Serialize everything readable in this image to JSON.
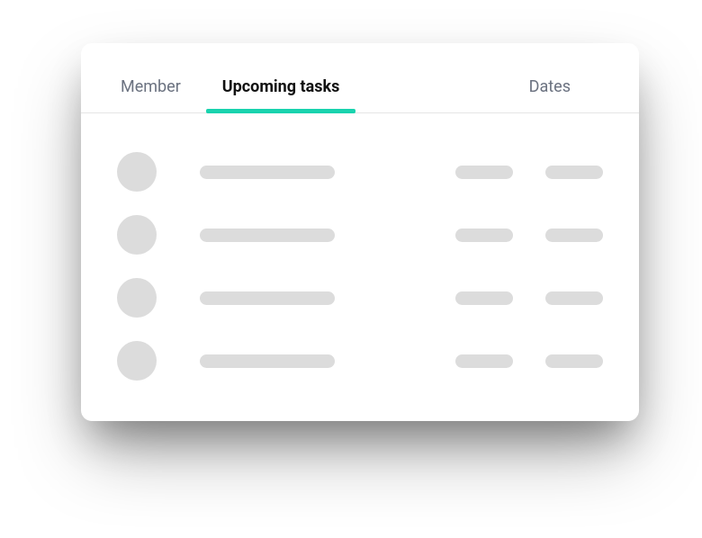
{
  "tabs": {
    "member": "Member",
    "upcoming": "Upcoming tasks",
    "dates": "Dates",
    "active": "upcoming"
  },
  "accent_color": "#19d3ae",
  "placeholder_color": "#dcdcdc",
  "rows": [
    {
      "avatar": "",
      "task": "",
      "date_start": "",
      "date_end": ""
    },
    {
      "avatar": "",
      "task": "",
      "date_start": "",
      "date_end": ""
    },
    {
      "avatar": "",
      "task": "",
      "date_start": "",
      "date_end": ""
    },
    {
      "avatar": "",
      "task": "",
      "date_start": "",
      "date_end": ""
    }
  ]
}
